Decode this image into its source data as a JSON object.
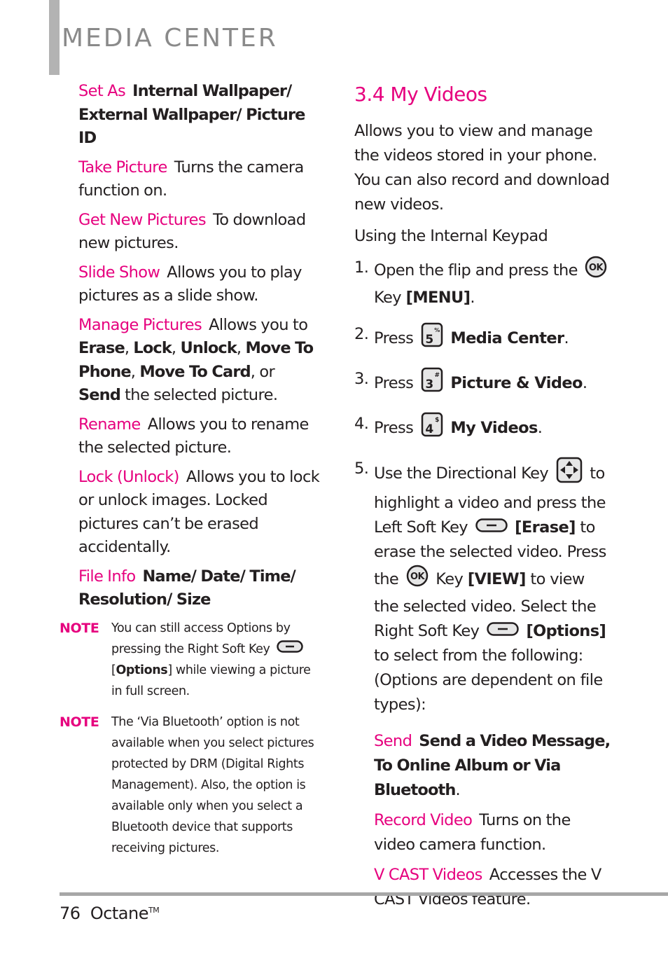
{
  "header": {
    "section_title": "MEDIA CENTER"
  },
  "left_column": {
    "entries": [
      {
        "term": "Set As",
        "desc": "Internal Wallpaper/ External Wallpaper/ Picture ID"
      },
      {
        "term": "Take Picture",
        "desc": "Turns the camera function on."
      },
      {
        "term": "Get New Pictures",
        "desc": "To download new pictures."
      },
      {
        "term": "Slide Show",
        "desc": "Allows you to play pictures as a slide show."
      },
      {
        "term": "Manage Pictures",
        "desc_prefix": "Allows you to",
        "options": [
          "Erase",
          "Lock",
          "Unlock",
          "Move To Phone",
          "Move To Card",
          "Send"
        ],
        "conj": "or",
        "desc_suffix": "the selected picture."
      },
      {
        "term": "Rename",
        "desc": "Allows you to rename the selected picture."
      },
      {
        "term": "Lock (Unlock)",
        "desc": "Allows you to lock or unlock images. Locked pictures can’t be erased accidentally."
      },
      {
        "term": "File Info",
        "desc": "Name/ Date/ Time/ Resolution/ Size"
      }
    ],
    "notes": [
      {
        "label": "NOTE",
        "text_a": "You can still access Options by pressing the Right Soft Key",
        "bold": "Options",
        "text_b": "while viewing a picture in full screen."
      },
      {
        "label": "NOTE",
        "text": "The ‘Via Bluetooth’ option is not available when you select pictures protected by DRM (Digital Rights Management). Also, the option is available only when you select a Bluetooth device that supports receiving pictures."
      }
    ]
  },
  "right_column": {
    "heading": "3.4 My Videos",
    "intro": "Allows you to view and manage the videos stored in your phone. You can also record and download new videos.",
    "subheading": "Using the Internal Keypad",
    "steps": [
      {
        "num": "1.",
        "text_a": "Open the flip and press the",
        "icon": "ok-key-icon",
        "text_b": "Key",
        "bold": "[MENU]",
        "end": "."
      },
      {
        "num": "2.",
        "text_a": "Press",
        "key": "5",
        "key_sym": "%",
        "bold": "Media Center",
        "end": "."
      },
      {
        "num": "3.",
        "text_a": "Press",
        "key": "3",
        "key_sym": "#",
        "bold": "Picture & Video",
        "end": "."
      },
      {
        "num": "4.",
        "text_a": "Press",
        "key": "4",
        "key_sym": "$",
        "bold": "My Videos",
        "end": "."
      },
      {
        "num": "5.",
        "p1": "Use the Directional Key",
        "p2": "to highlight a video and press the Left Soft Key",
        "b1": "[Erase]",
        "p3": "to erase the selected video. Press the",
        "p4": "Key",
        "b2": "[VIEW]",
        "p5": "to view the selected video. Select the Right Soft Key",
        "b3": "[Options]",
        "p6": "to select from the following: (Options are dependent on file types):"
      }
    ],
    "options": [
      {
        "term": "Send",
        "desc": "Send a Video Message, To Online Album or Via Bluetooth",
        "end": "."
      },
      {
        "term": "Record Video",
        "desc": "Turns on the video camera function."
      },
      {
        "term": "V CAST Videos",
        "desc": "Accesses the V CAST Videos feature."
      }
    ]
  },
  "footer": {
    "page_number": "76",
    "product": "Octane",
    "trademark": "TM"
  },
  "colors": {
    "accent": "#e6007e",
    "text": "#231f20",
    "title_gray": "#8a8a8a",
    "rule_gray": "#a7a7a7"
  }
}
